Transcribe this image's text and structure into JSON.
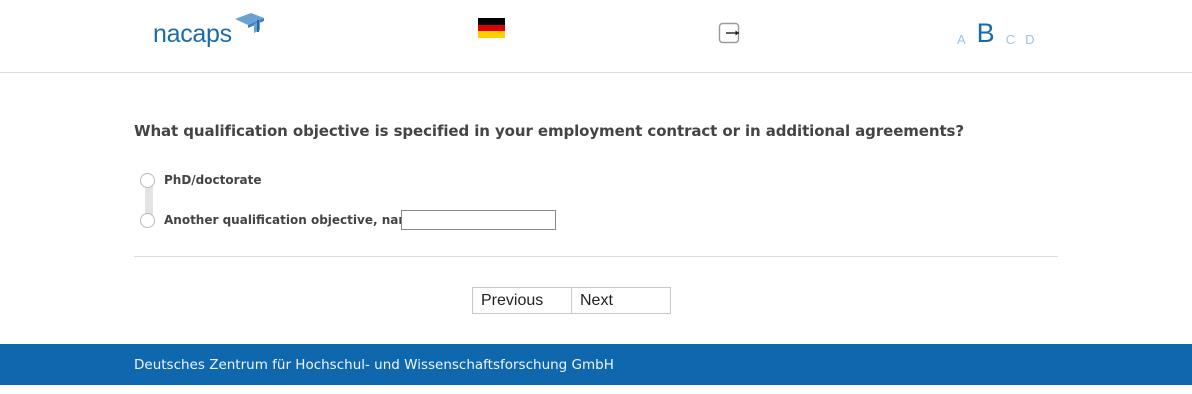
{
  "header": {
    "logo_text": "nacaps",
    "language_flag": "german-flag-icon",
    "logout_icon": "logout-icon",
    "font_sizes": [
      "A",
      "B",
      "C",
      "D"
    ],
    "active_font_size": "B"
  },
  "colors": {
    "brand_blue": "#1a6bab",
    "font_size_inactive": "#9cc3e6",
    "footer_bg": "#0f68ae",
    "flag_black": "#000000",
    "flag_red": "#dd0000",
    "flag_gold": "#ffce00"
  },
  "question": {
    "text": "What qualification objective is specified in your employment contract or in additional agreements?",
    "options": [
      {
        "label": "PhD/doctorate"
      },
      {
        "label": "Another qualification objective, namely:",
        "input_value": ""
      }
    ]
  },
  "navigation": {
    "previous_label": "Previous",
    "next_label": "Next"
  },
  "footer": {
    "text": "Deutsches Zentrum für Hochschul- und Wissenschaftsforschung GmbH"
  }
}
